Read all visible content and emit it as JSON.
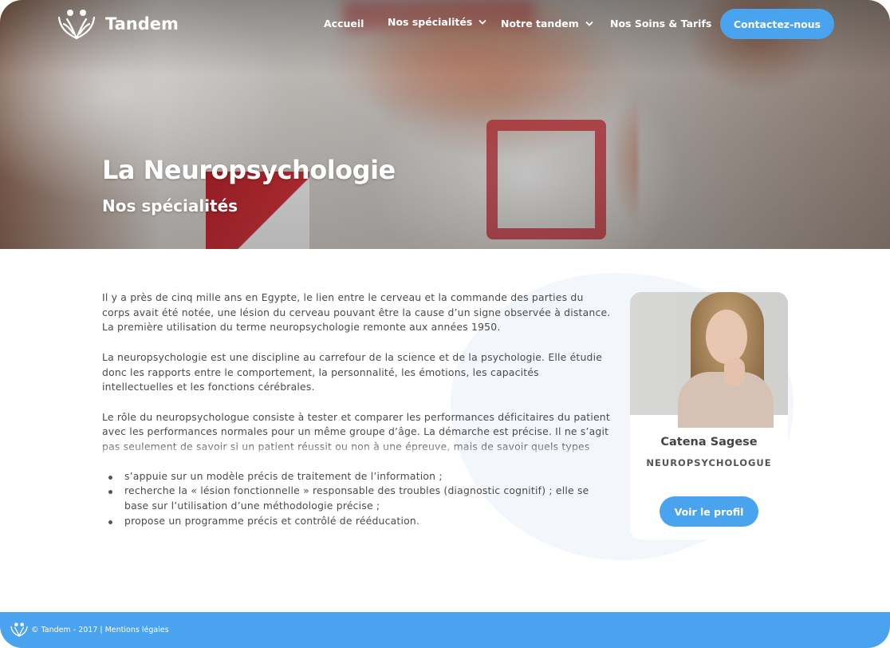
{
  "brand": {
    "name": "Tandem"
  },
  "nav": {
    "items": [
      {
        "label": "Accueil"
      },
      {
        "label": "Nos spécialités"
      },
      {
        "label": "Notre tandem"
      },
      {
        "label": "Nos Soins & Tarifs"
      }
    ],
    "cta_label": "Contactez-nous"
  },
  "hero": {
    "title": "La Neuropsychologie",
    "subtitle": "Nos spécialités"
  },
  "article": {
    "p1": "Il y a près de cinq mille ans en Egypte, le lien entre le cerveau et la commande des parties du corps avait été notée, une lésion du cerveau pouvant être la cause d’un signe observée à distance.",
    "p1b": "La première utilisation du terme neuropsychologie remonte aux années 1950.",
    "p2": "La neuropsychologie est une discipline au carrefour de la science et de la psychologie. Elle étudie donc les rapports entre le comportement, la personnalité, les émotions, les capacités intellectuelles et les fonctions cérébrales.",
    "p3": "Le rôle du neuropsychologue consiste à tester et comparer les performances déficitaires du patient avec les performances normales pour un même groupe d’âge. La démarche est précise. Il ne s’agit pas seulement de savoir si un patient réussit ou non à une épreuve, mais de savoir quels types d’erreurs il commet et quels sont les facteurs cause de la déficit et possible…",
    "bullets": [
      "s’appuie sur un modèle précis de traitement de l’information ;",
      "recherche la « lésion fonctionnelle » responsable des troubles (diagnostic cognitif) ; elle se base sur l’utilisation d’une méthodologie précise ;",
      "propose un programme précis et contrôlé de rééducation."
    ]
  },
  "profile": {
    "name": "Catena Sagese",
    "role": "NEUROPSYCHOLOGUE",
    "button_label": "Voir le profil"
  },
  "footer": {
    "text": "© Tandem - 2017 | Mentions légales"
  },
  "colors": {
    "accent": "#4aa3ef",
    "text": "#4a4a4a",
    "blob": "#f3f6fb"
  }
}
